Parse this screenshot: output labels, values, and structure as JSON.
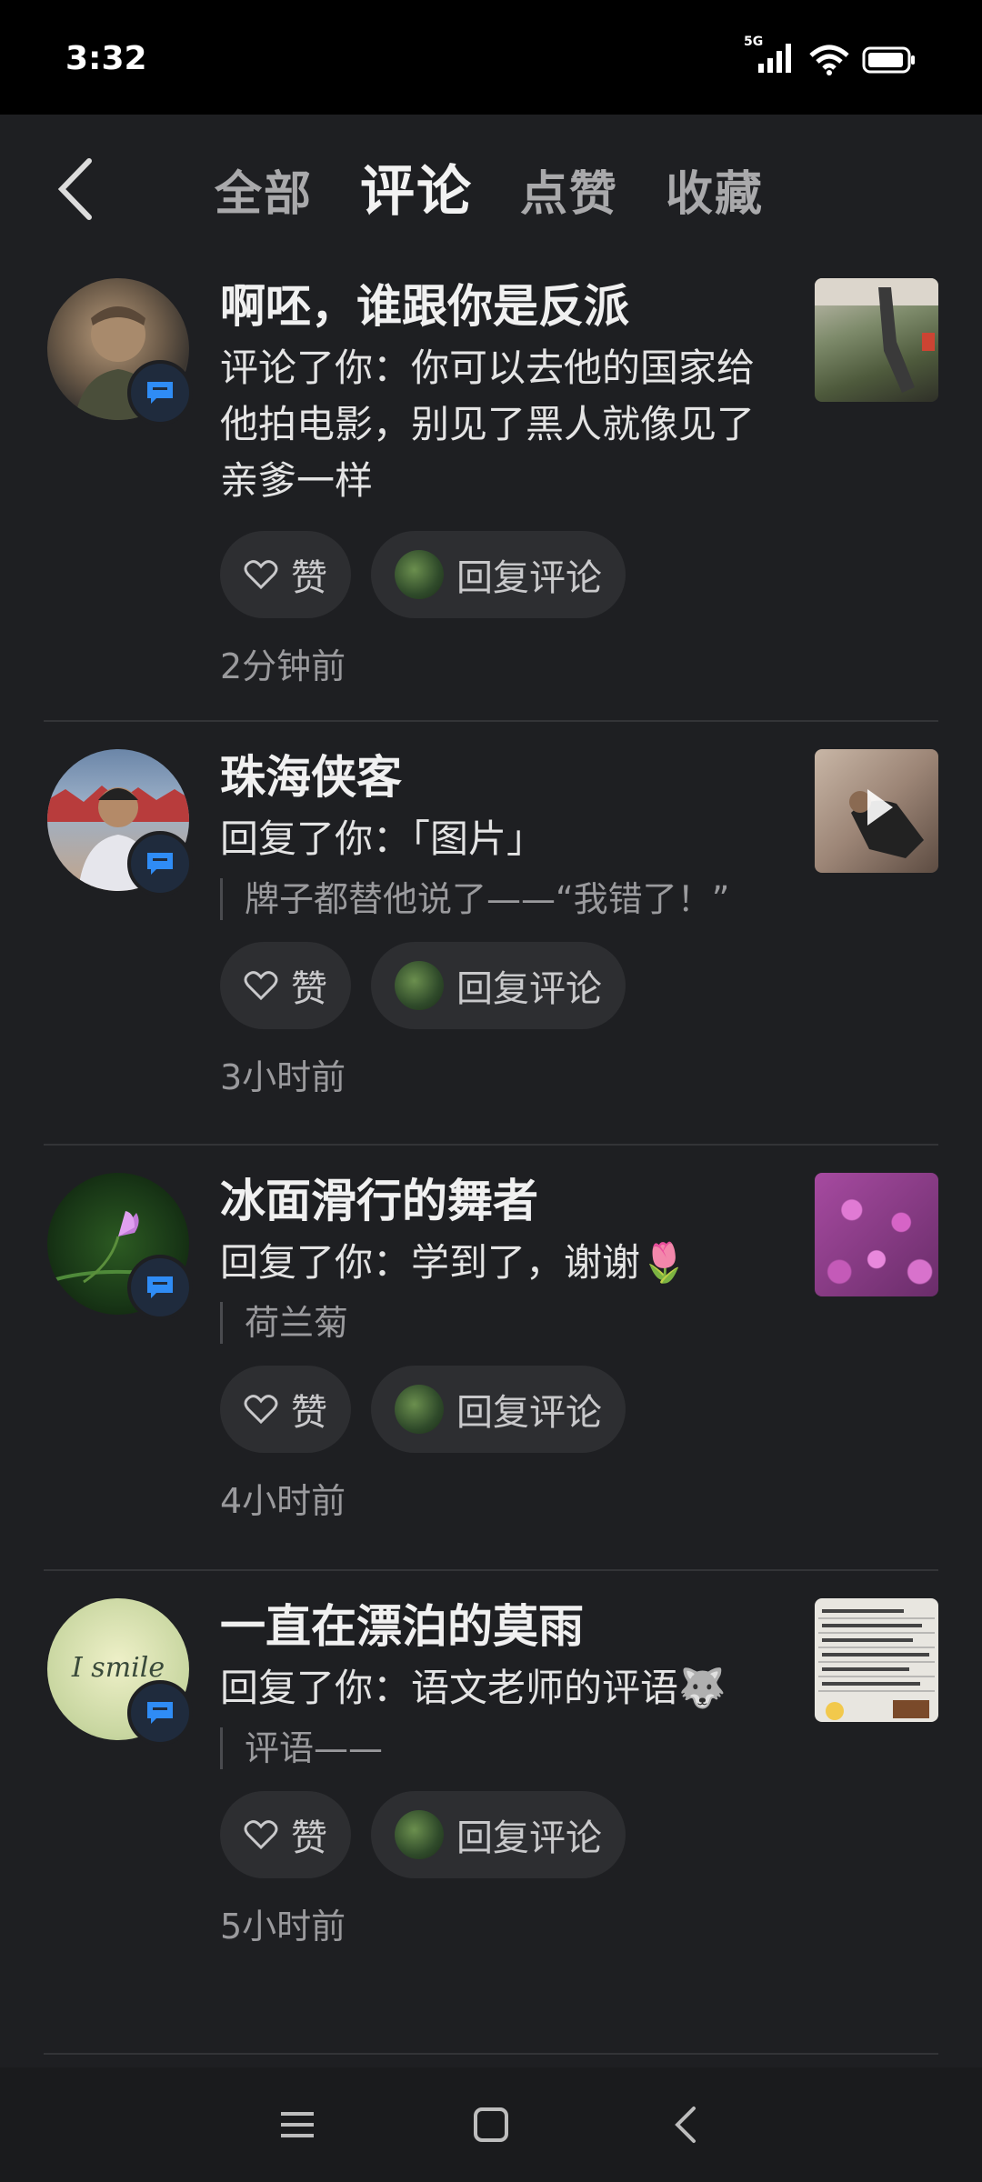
{
  "status": {
    "time": "3:32",
    "network": "5G"
  },
  "tabs": [
    {
      "label": "全部"
    },
    {
      "label": "评论"
    },
    {
      "label": "点赞"
    },
    {
      "label": "收藏"
    }
  ],
  "items": [
    {
      "username": "啊呸，谁跟你是反派",
      "comment": "评论了你：你可以去他的国家给他拍电影，别见了黑人就像见了亲爹一样",
      "quote": "",
      "like_label": "赞",
      "reply_label": "回复评论",
      "time": "2分钟前"
    },
    {
      "username": "珠海侠客",
      "comment": "回复了你：「图片」",
      "quote": "牌子都替他说了——“我错了！”",
      "like_label": "赞",
      "reply_label": "回复评论",
      "time": "3小时前"
    },
    {
      "username": "冰面滑行的舞者",
      "comment": "回复了你：学到了，谢谢🌷",
      "quote": "荷兰菊",
      "like_label": "赞",
      "reply_label": "回复评论",
      "time": "4小时前"
    },
    {
      "username": "一直在漂泊的莫雨",
      "comment": "回复了你：语文老师的评语🐺",
      "quote": "评语——",
      "like_label": "赞",
      "reply_label": "回复评论",
      "time": "5小时前"
    }
  ],
  "avatar_text": {
    "item4": "I smile"
  }
}
